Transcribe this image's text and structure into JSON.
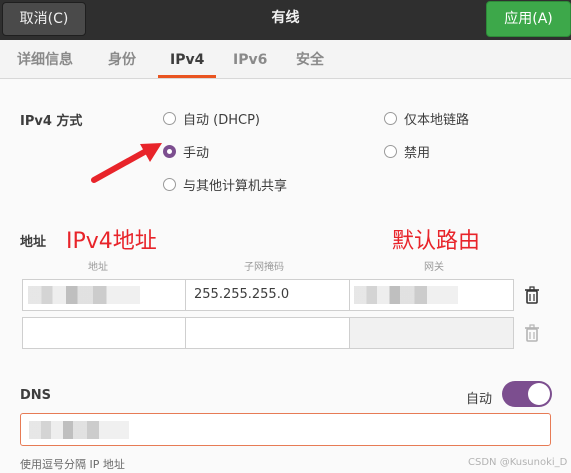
{
  "header": {
    "cancel_label": "取消(C)",
    "title": "有线",
    "apply_label": "应用(A)"
  },
  "tabs": [
    {
      "label": "详细信息"
    },
    {
      "label": "身份"
    },
    {
      "label": "IPv4",
      "active": true
    },
    {
      "label": "IPv6"
    },
    {
      "label": "安全"
    }
  ],
  "ipv4": {
    "method_label": "IPv4 方式",
    "options": {
      "auto_dhcp": "自动 (DHCP)",
      "link_local": "仅本地链路",
      "manual": "手动",
      "disabled": "禁用",
      "shared": "与其他计算机共享"
    },
    "selected": "手动"
  },
  "annotations": {
    "ipv4_address": "IPv4地址",
    "default_gateway": "默认路由"
  },
  "addresses": {
    "section_label": "地址",
    "columns": [
      "地址",
      "子网掩码",
      "网关"
    ],
    "rows": [
      {
        "address": "",
        "netmask": "255.255.255.0",
        "gateway": ""
      },
      {
        "address": "",
        "netmask": "",
        "gateway": ""
      }
    ]
  },
  "dns": {
    "label": "DNS",
    "auto_label": "自动",
    "auto_enabled": true,
    "helper": "使用逗号分隔 IP 地址"
  },
  "watermark": "CSDN @Kusunoki_D",
  "colors": {
    "accent": "#7c4e8f",
    "apply_green": "#3da84a",
    "tab_underline": "#e95420",
    "annotation_red": "#e8242a"
  }
}
